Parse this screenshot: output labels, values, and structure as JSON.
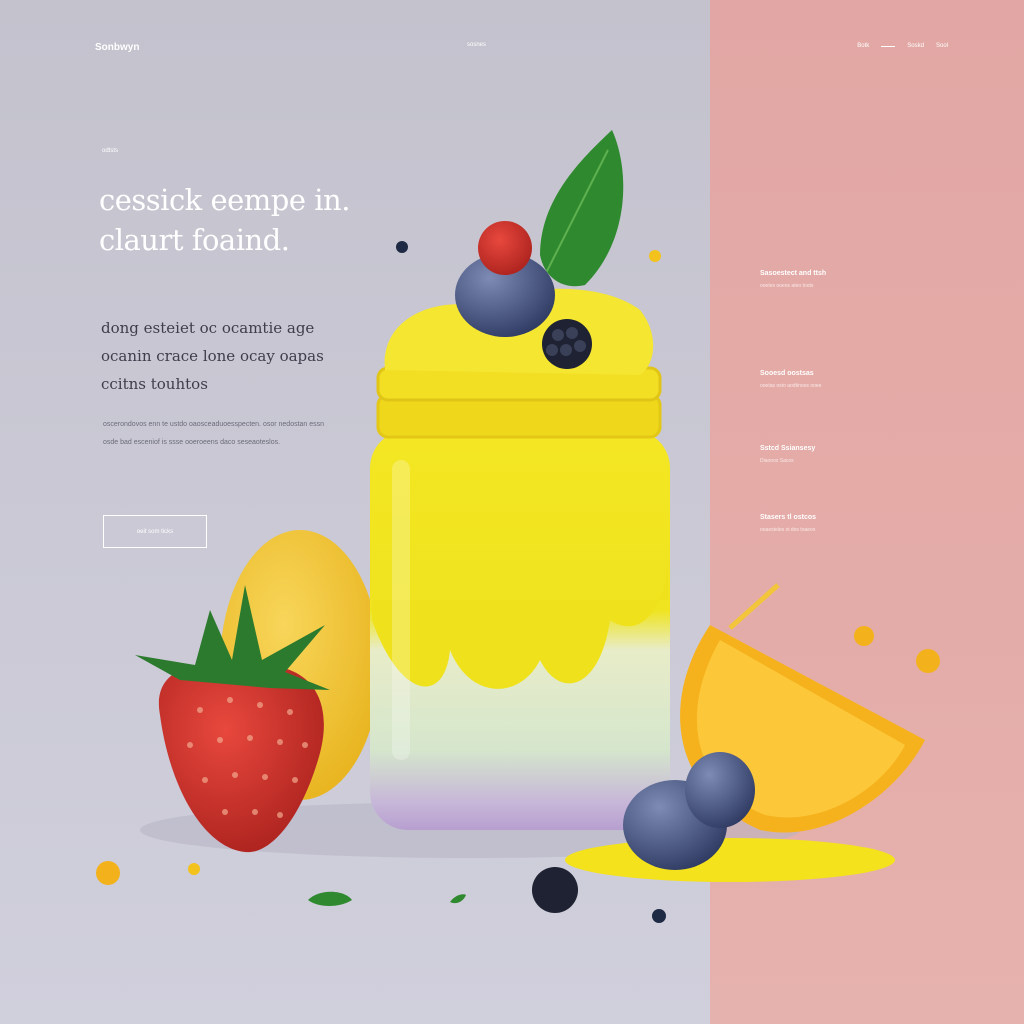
{
  "header": {
    "brand": "Sonbwyn",
    "nav_center": "sosnes",
    "nav_right": [
      "Botk",
      "Soskd",
      "Sool"
    ]
  },
  "hero": {
    "kicker": "odtsts",
    "headline": "cessick eempe in. claurt foaind.",
    "subhead": "dong esteiet oc ocamtie age ocanin crace lone ocay oapas ccitns touhtos",
    "body": "oscerondovos enn te ustdo oaosceaduoesspecten. osor nedostan essn osde bad esceniof is ssse ooeroeens daco seseaoteslos.",
    "cta_label": "oeit som ticks"
  },
  "sidebar": [
    {
      "title": "Sasoestect and ttsh",
      "sub": "ooetes ooeos ateo toots"
    },
    {
      "title": "Sooesd oostsas",
      "sub": "ooetas osto aodtinoos ooee"
    },
    {
      "title": "Sstcd Ssiansesy",
      "sub": "Diaoeos Sacos"
    },
    {
      "title": "Stasers tl ostcos",
      "sub": "ooaesteles oi dos toaeos"
    }
  ],
  "art": {
    "subject": "smoothie-jar-with-fruits",
    "colors": {
      "left_bg": "#c6c5d1",
      "right_bg": "#e3aaa6",
      "smoothie_yellow": "#f2e41c",
      "smoothie_green": "#d9e6cf",
      "smoothie_purple": "#b9a3d0",
      "strawberry": "#d0352d",
      "blueberry": "#3d4c7a",
      "orange": "#f6b21d",
      "lemon": "#f2c839",
      "leaf": "#2f8a2f"
    }
  }
}
